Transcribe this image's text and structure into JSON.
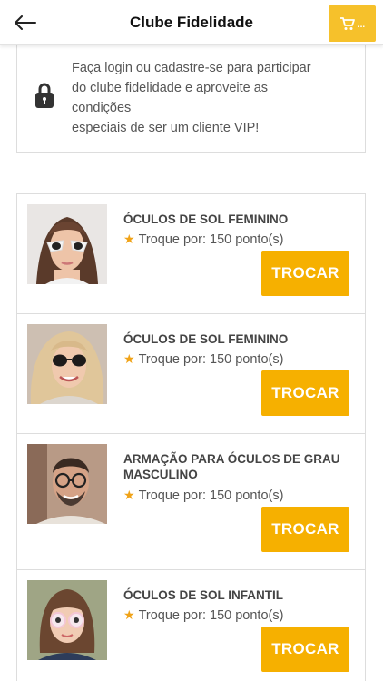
{
  "header": {
    "title": "Clube Fidelidade",
    "cart_dots": "...",
    "accent_color": "#f6c12b"
  },
  "login": {
    "lines": [
      "Faça login ou cadastre-se para participar",
      "do clube fidelidade e aproveite as",
      "condições",
      "especiais de ser um cliente VIP!"
    ]
  },
  "products": [
    {
      "name": "ÓCULOS DE SOL FEMININO",
      "points_text": "Troque por: 150 ponto(s)",
      "button": "TROCAR"
    },
    {
      "name": "ÓCULOS DE SOL FEMININO",
      "points_text": "Troque por: 150 ponto(s)",
      "button": "TROCAR"
    },
    {
      "name": "ARMAÇÃO PARA ÓCULOS DE GRAU MASCULINO",
      "points_text": "Troque por: 150 ponto(s)",
      "button": "TROCAR"
    },
    {
      "name": "ÓCULOS DE SOL INFANTIL",
      "points_text": "Troque por: 150 ponto(s)",
      "button": "TROCAR"
    }
  ],
  "icons": {
    "back": "arrow-left-icon",
    "cart": "shopping-cart-icon",
    "lock": "lock-icon",
    "star": "star-icon"
  }
}
